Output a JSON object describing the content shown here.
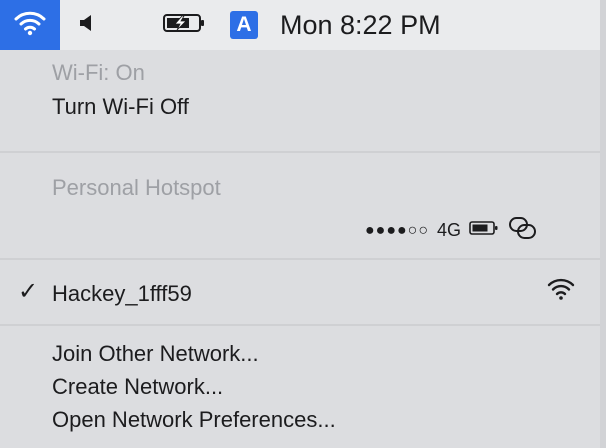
{
  "menubar": {
    "clock": "Mon 8:22 PM",
    "input_source": "A",
    "icons": [
      "wifi-icon",
      "volume-icon",
      "battery-charging-icon",
      "input-source-icon"
    ],
    "accent_color": "#2d6fe6"
  },
  "menu": {
    "wifi_status": "Wi-Fi: On",
    "toggle_label": "Turn Wi-Fi Off",
    "hotspot_header": "Personal Hotspot",
    "hotspot": {
      "signal": "●●●●○○",
      "network_type": "4G",
      "icons": [
        "hotspot-battery-icon",
        "hotspot-link-icon"
      ]
    },
    "network": {
      "check": "✓",
      "name": "Hackey_1fff59",
      "icon": "wifi-signal-icon"
    },
    "join_label": "Join Other Network...",
    "create_label": "Create Network...",
    "prefs_label": "Open Network Preferences..."
  }
}
